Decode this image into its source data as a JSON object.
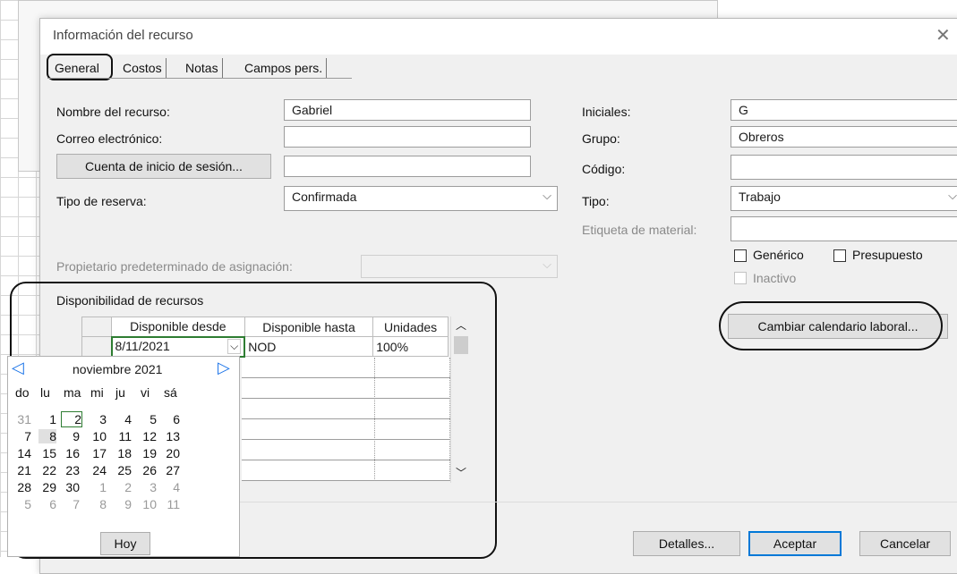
{
  "dialog": {
    "title": "Información del recurso",
    "close_glyph": "✕"
  },
  "tabs": [
    {
      "label": "General"
    },
    {
      "label": "Costos"
    },
    {
      "label": "Notas"
    },
    {
      "label": "Campos pers."
    }
  ],
  "left": {
    "nombre_label": "Nombre del recurso:",
    "nombre_value": "Gabriel",
    "correo_label": "Correo electrónico:",
    "correo_value": "",
    "cuenta_button": "Cuenta de inicio de sesión...",
    "cuenta_value": "",
    "reserva_label": "Tipo de reserva:",
    "reserva_value": "Confirmada",
    "propietario_label": "Propietario predeterminado de asignación:",
    "propietario_value": ""
  },
  "right": {
    "iniciales_label": "Iniciales:",
    "iniciales_value": "G",
    "grupo_label": "Grupo:",
    "grupo_value": "Obreros",
    "codigo_label": "Código:",
    "codigo_value": "",
    "tipo_label": "Tipo:",
    "tipo_value": "Trabajo",
    "etiqueta_label": "Etiqueta de material:",
    "etiqueta_value": "",
    "generico_label": "Genérico",
    "presupuesto_label": "Presupuesto",
    "inactivo_label": "Inactivo",
    "calendario_button": "Cambiar calendario laboral..."
  },
  "availability": {
    "title": "Disponibilidad de recursos",
    "columns": [
      "Disponible desde",
      "Disponible hasta",
      "Unidades"
    ],
    "rows": [
      {
        "desde": "8/11/2021",
        "hasta": "NOD",
        "unidades": "100%"
      }
    ]
  },
  "calendar": {
    "month_label": "noviembre 2021",
    "weekdays": [
      "do",
      "lu",
      "ma",
      "mi",
      "ju",
      "vi",
      "sá"
    ],
    "weeks": [
      [
        {
          "d": "31",
          "o": true
        },
        {
          "d": "1"
        },
        {
          "d": "2"
        },
        {
          "d": "3"
        },
        {
          "d": "4"
        },
        {
          "d": "5"
        },
        {
          "d": "6"
        }
      ],
      [
        {
          "d": "7"
        },
        {
          "d": "8"
        },
        {
          "d": "9"
        },
        {
          "d": "10"
        },
        {
          "d": "11"
        },
        {
          "d": "12"
        },
        {
          "d": "13"
        }
      ],
      [
        {
          "d": "14"
        },
        {
          "d": "15"
        },
        {
          "d": "16"
        },
        {
          "d": "17"
        },
        {
          "d": "18"
        },
        {
          "d": "19"
        },
        {
          "d": "20"
        }
      ],
      [
        {
          "d": "21"
        },
        {
          "d": "22"
        },
        {
          "d": "23"
        },
        {
          "d": "24"
        },
        {
          "d": "25"
        },
        {
          "d": "26"
        },
        {
          "d": "27"
        }
      ],
      [
        {
          "d": "28"
        },
        {
          "d": "29"
        },
        {
          "d": "30"
        },
        {
          "d": "1",
          "o": true
        },
        {
          "d": "2",
          "o": true
        },
        {
          "d": "3",
          "o": true
        },
        {
          "d": "4",
          "o": true
        }
      ],
      [
        {
          "d": "5",
          "o": true
        },
        {
          "d": "6",
          "o": true
        },
        {
          "d": "7",
          "o": true
        },
        {
          "d": "8",
          "o": true
        },
        {
          "d": "9",
          "o": true
        },
        {
          "d": "10",
          "o": true
        },
        {
          "d": "11",
          "o": true
        }
      ]
    ],
    "today_button": "Hoy"
  },
  "footer": {
    "detalles": "Detalles...",
    "aceptar": "Aceptar",
    "cancelar": "Cancelar"
  },
  "colors": {
    "accent": "#0078d7",
    "calendar_arrow": "#1a73e8",
    "selected_cell": "#2e7d32"
  }
}
